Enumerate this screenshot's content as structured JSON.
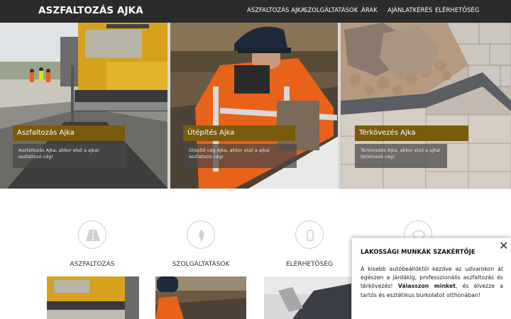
{
  "header": {
    "brand": "ASZFALTOZÁS AJKA",
    "nav": [
      {
        "label": "ASZFALTOZÁS AJKA"
      },
      {
        "label": "SZOLGÁLTATÁSOK",
        "caret": "⌄"
      },
      {
        "label": "ÁRAK"
      },
      {
        "label": "AJÁNLATKÉRÉS"
      },
      {
        "label": "ELÉRHETŐSÉG"
      }
    ]
  },
  "hero": {
    "panels": [
      {
        "title": "Aszfaltozás Ajka",
        "description": "Aszfaltozás Ajka, akkor első a ajkai aszfaltozó cég!"
      },
      {
        "title": "Útépítés Ajka",
        "description": "Útépítő cég Ajka, akkor első a ajkai aszfaltozó cég!"
      },
      {
        "title": "Térkövezés Ajka",
        "description": "Térkövezés Ajka, akkor első a ajkai térkövező cég!"
      }
    ]
  },
  "features": [
    {
      "label": "ASZFALTOZÁS",
      "icon": "road-icon"
    },
    {
      "label": "SZOLGÁLTATÁSOK",
      "icon": "leaf-icon"
    },
    {
      "label": "ELÉRHETŐSÉG",
      "icon": "phone-icon"
    },
    {
      "label": "",
      "icon": "chat-icon"
    }
  ],
  "popup": {
    "close": "✕",
    "title": "LAKOSSÁGI MUNKÁK SZAKÉRTŐJE",
    "body_before": "A kisebb autóbeállóktól kezdve az udvarokon át egészen a járdákig, professzionális aszfaltozás és térkövezés! ",
    "body_bold": "Válasszon minket",
    "body_after": ", és élvezze a tartós és esztétikus burkolatot otthonában!"
  },
  "colors": {
    "navbar": "#2b2b2b",
    "accent": "#7a5a0d",
    "safety_orange": "#e8621a"
  }
}
